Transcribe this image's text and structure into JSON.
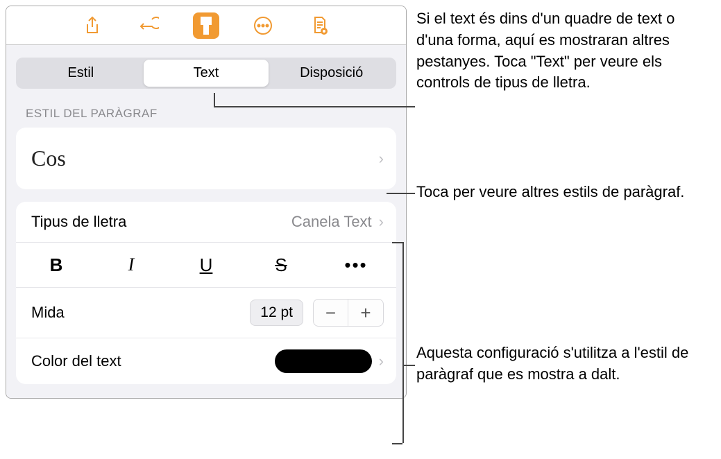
{
  "toolbar": {
    "share": "share",
    "undo": "undo",
    "format": "format-brush",
    "more": "more",
    "document": "document"
  },
  "tabs": {
    "style": "Estil",
    "text": "Text",
    "layout": "Disposició"
  },
  "paragraph": {
    "section_label": "ESTIL DEL PARÀGRAF",
    "style_name": "Cos"
  },
  "font": {
    "label": "Tipus de lletra",
    "value": "Canela Text",
    "bold": "B",
    "italic": "I",
    "underline": "U",
    "strike": "S",
    "more": "•••"
  },
  "size": {
    "label": "Mida",
    "value": "12 pt",
    "minus": "−",
    "plus": "+"
  },
  "color": {
    "label": "Color del text"
  },
  "annotations": {
    "a1": "Si el text és dins d'un quadre de text o d'una forma, aquí es mostraran altres pestanyes. Toca \"Text\" per veure els controls de tipus de lletra.",
    "a2": "Toca per veure altres estils de paràgraf.",
    "a3": "Aquesta configuració s'utilitza a l'estil de paràgraf que es mostra a dalt."
  }
}
